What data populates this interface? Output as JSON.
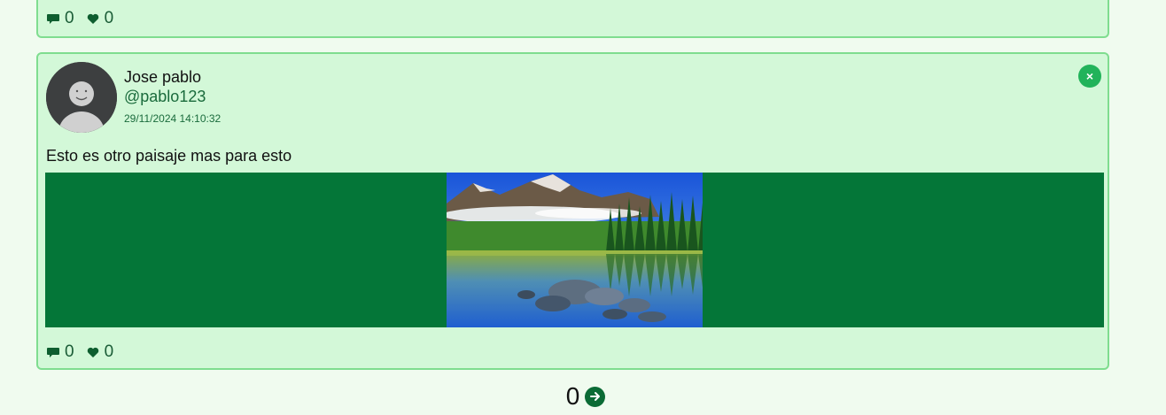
{
  "previous_post": {
    "comment_count": "0",
    "like_count": "0"
  },
  "post": {
    "author_name": "Jose pablo",
    "handle": "@pablo123",
    "date": "29/11/2024 14:10:32",
    "text": "Esto es otro paisaje mas para esto",
    "close_label": "×",
    "image_icon": "mountain-lake-landscape",
    "comment_count": "0",
    "like_count": "0"
  },
  "pagination": {
    "current_page": "0",
    "next_icon": "arrow-right-icon"
  },
  "colors": {
    "card_bg": "#d3f8d8",
    "card_border": "#7fdd8f",
    "media_bg": "#047638",
    "accent": "#21b35a",
    "text_green": "#1a6b3c"
  }
}
